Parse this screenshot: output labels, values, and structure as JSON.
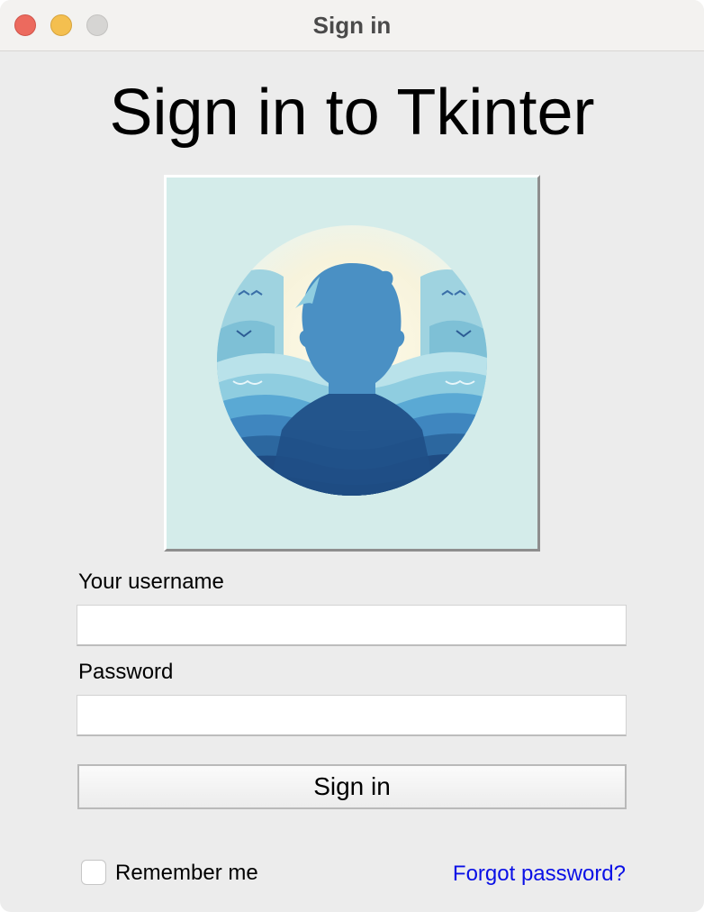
{
  "window": {
    "title": "Sign in"
  },
  "heading": "Sign in to Tkinter",
  "avatar": {
    "icon": "person-silhouette-waves-icon"
  },
  "form": {
    "username_label": "Your username",
    "username_value": "",
    "password_label": "Password",
    "password_value": "",
    "submit_label": "Sign in"
  },
  "footer": {
    "remember_label": "Remember me",
    "remember_checked": false,
    "forgot_link": "Forgot password?"
  },
  "colors": {
    "link": "#0a10e6",
    "window_bg": "#ececec",
    "titlebar_bg": "#f3f2f0"
  }
}
